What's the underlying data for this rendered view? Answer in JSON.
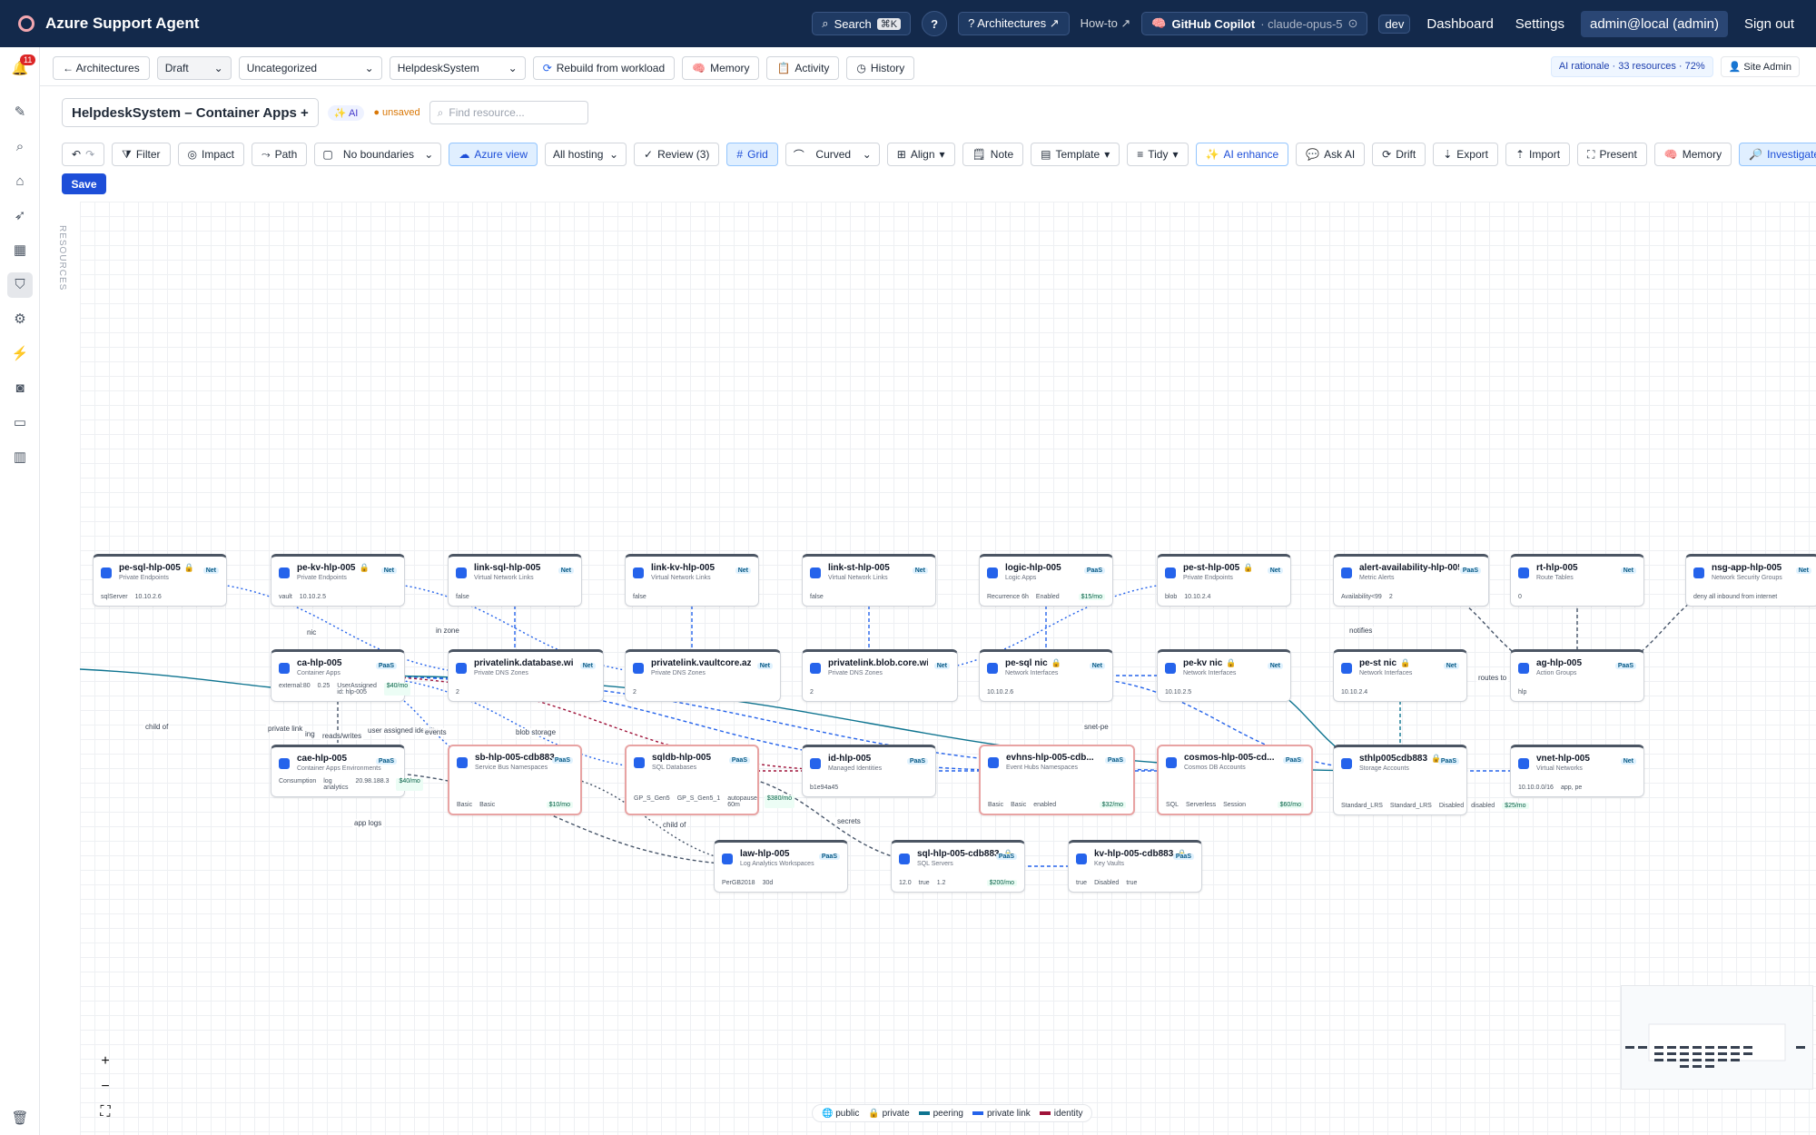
{
  "app": {
    "title": "Azure Support Agent"
  },
  "topbar": {
    "search_label": "Search",
    "search_kbd": "⌘K",
    "help": "?",
    "architectures": "? Architectures ↗",
    "howto": "How-to ↗",
    "copilot": "GitHub Copilot",
    "copilot_model": "· claude-opus-5",
    "env": "dev",
    "dashboard": "Dashboard",
    "settings": "Settings",
    "user": "admin@local (admin)",
    "signout": "Sign out"
  },
  "sidebar": {
    "notifications": "11"
  },
  "row2": {
    "back": "← Architectures",
    "status": "Draft",
    "category": "Uncategorized",
    "system": "HelpdeskSystem",
    "rebuild": "Rebuild from workload",
    "memory": "Memory",
    "activity": "Activity",
    "history": "History",
    "ai_rationale": "AI rationale · 33 resources · 72%",
    "site_admin": "Site Admin"
  },
  "diagram": {
    "title": "HelpdeskSystem – Container Apps +",
    "ai_tag": "AI",
    "unsaved": "unsaved",
    "find_placeholder": "Find resource..."
  },
  "toolbar": {
    "filter": "Filter",
    "impact": "Impact",
    "path": "Path",
    "boundaries": "No boundaries",
    "azure_view": "Azure view",
    "hosting": "All hosting",
    "review": "Review (3)",
    "grid": "Grid",
    "curved": "Curved",
    "align": "Align",
    "note": "Note",
    "template": "Template",
    "tidy": "Tidy",
    "ai_enhance": "AI enhance",
    "ask_ai": "Ask AI",
    "drift": "Drift",
    "export": "Export",
    "import": "Import",
    "present": "Present",
    "memory": "Memory",
    "investigate": "Investigate",
    "save": "Save"
  },
  "resources_tab": "RESOURCES",
  "nodes": [
    {
      "name": "pe-sql-hlp-005",
      "type": "Private Endpoints",
      "tag": "Net",
      "lock": true,
      "f": [
        "sqlServer",
        "10.10.2.6"
      ]
    },
    {
      "name": "pe-kv-hlp-005",
      "type": "Private Endpoints",
      "tag": "Net",
      "lock": true,
      "f": [
        "vault",
        "10.10.2.5"
      ]
    },
    {
      "name": "link-sql-hlp-005",
      "type": "Virtual Network Links",
      "tag": "Net",
      "f": [
        "false"
      ]
    },
    {
      "name": "link-kv-hlp-005",
      "type": "Virtual Network Links",
      "tag": "Net",
      "f": [
        "false"
      ]
    },
    {
      "name": "link-st-hlp-005",
      "type": "Virtual Network Links",
      "tag": "Net",
      "f": [
        "false"
      ]
    },
    {
      "name": "logic-hlp-005",
      "type": "Logic Apps",
      "tag": "PaaS",
      "f": [
        "Recurrence 6h",
        "Enabled"
      ],
      "cost": "$15/mo"
    },
    {
      "name": "pe-st-hlp-005",
      "type": "Private Endpoints",
      "tag": "Net",
      "lock": true,
      "f": [
        "blob",
        "10.10.2.4"
      ]
    },
    {
      "name": "alert-availability-hlp-005",
      "type": "Metric Alerts",
      "tag": "PaaS",
      "f": [
        "Availability<99",
        "2"
      ]
    },
    {
      "name": "rt-hlp-005",
      "type": "Route Tables",
      "tag": "Net",
      "f": [
        "0"
      ]
    },
    {
      "name": "nsg-app-hlp-005",
      "type": "Network Security Groups",
      "tag": "Net",
      "f": [
        "deny all inbound from internet"
      ]
    },
    {
      "name": "ca-hlp-005",
      "type": "Container Apps",
      "tag": "PaaS",
      "f": [
        "external:80",
        "0.25",
        "UserAssigned id: hlp-005"
      ],
      "cost": "$40/mo"
    },
    {
      "name": "privatelink.database.win...",
      "type": "Private DNS Zones",
      "tag": "Net",
      "f": [
        "2"
      ]
    },
    {
      "name": "privatelink.vaultcore.azu...",
      "type": "Private DNS Zones",
      "tag": "Net",
      "f": [
        "2"
      ]
    },
    {
      "name": "privatelink.blob.core.win...",
      "type": "Private DNS Zones",
      "tag": "Net",
      "f": [
        "2"
      ]
    },
    {
      "name": "pe-sql nic",
      "type": "Network Interfaces",
      "tag": "Net",
      "lock": true,
      "f": [
        "10.10.2.6"
      ]
    },
    {
      "name": "pe-kv nic",
      "type": "Network Interfaces",
      "tag": "Net",
      "lock": true,
      "f": [
        "10.10.2.5"
      ]
    },
    {
      "name": "pe-st nic",
      "type": "Network Interfaces",
      "tag": "Net",
      "lock": true,
      "f": [
        "10.10.2.4"
      ]
    },
    {
      "name": "ag-hlp-005",
      "type": "Action Groups",
      "tag": "PaaS",
      "f": [
        "hlp"
      ]
    },
    {
      "name": "cae-hlp-005",
      "type": "Container Apps Environments",
      "tag": "PaaS",
      "f": [
        "Consumption",
        "log analytics",
        "20.98.188.3"
      ],
      "cost": "$40/mo"
    },
    {
      "name": "sb-hlp-005-cdb883",
      "type": "Service Bus Namespaces",
      "tag": "PaaS",
      "red": true,
      "f": [
        "Basic",
        "Basic"
      ],
      "cost": "$10/mo"
    },
    {
      "name": "sqldb-hlp-005",
      "type": "SQL Databases",
      "tag": "PaaS",
      "red": true,
      "f": [
        "GP_S_Gen5",
        "GP_S_Gen5_1",
        "autopause 60m"
      ],
      "cost": "$380/mo"
    },
    {
      "name": "id-hlp-005",
      "type": "Managed Identities",
      "tag": "PaaS",
      "f": [
        "b1e94a45"
      ]
    },
    {
      "name": "evhns-hlp-005-cdb...",
      "type": "Event Hubs Namespaces",
      "tag": "PaaS",
      "red": true,
      "f": [
        "Basic",
        "Basic",
        "enabled"
      ],
      "cost": "$32/mo"
    },
    {
      "name": "cosmos-hlp-005-cd...",
      "type": "Cosmos DB Accounts",
      "tag": "PaaS",
      "red": true,
      "f": [
        "SQL",
        "Serverless",
        "Session"
      ],
      "cost": "$60/mo"
    },
    {
      "name": "sthlp005cdb883",
      "type": "Storage Accounts",
      "tag": "PaaS",
      "lock": true,
      "f": [
        "Standard_LRS",
        "Standard_LRS",
        "Disabled",
        "disabled"
      ],
      "cost": "$25/mo"
    },
    {
      "name": "vnet-hlp-005",
      "type": "Virtual Networks",
      "tag": "Net",
      "f": [
        "10.10.0.0/16",
        "app, pe"
      ]
    },
    {
      "name": "law-hlp-005",
      "type": "Log Analytics Workspaces",
      "tag": "PaaS",
      "f": [
        "PerGB2018",
        "30d"
      ]
    },
    {
      "name": "sql-hlp-005-cdb883",
      "type": "SQL Servers",
      "tag": "PaaS",
      "lock": true,
      "f": [
        "12.0",
        "true",
        "1.2"
      ],
      "cost": "$200/mo"
    },
    {
      "name": "kv-hlp-005-cdb883",
      "type": "Key Vaults",
      "tag": "PaaS",
      "lock": true,
      "f": [
        "true",
        "Disabled",
        "true"
      ]
    }
  ],
  "edge_labels": [
    "child of",
    "private link",
    "ing",
    "reads/writes",
    "user assigned identity",
    "events",
    "blob storage",
    "app logs",
    "child of",
    "secrets",
    "in zone",
    "nic",
    "snet-pe",
    "notifies",
    "routes to"
  ],
  "legend": {
    "public": "public",
    "private": "private",
    "peering": "peering",
    "private_link": "private link",
    "identity": "identity"
  },
  "colors": {
    "topbar": "#13294b",
    "accent": "#1d4ed8",
    "peering": "#0e7490",
    "private_link": "#2563eb",
    "identity": "#9f1239"
  }
}
